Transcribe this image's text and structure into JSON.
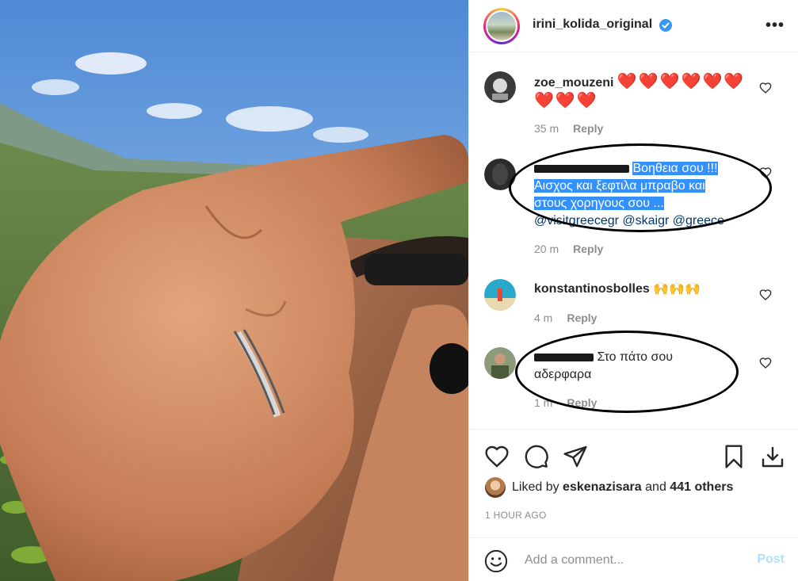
{
  "post": {
    "author": "irini_kolida_original",
    "menu_icon": "more-horizontal-icon"
  },
  "comments": [
    {
      "username": "zoe_mouzeni",
      "text": "❤️❤️❤️❤️❤️❤️❤️❤️❤️",
      "time": "35 m",
      "reply_label": "Reply"
    },
    {
      "username": "",
      "selected_text": "Βοηθεια σου !!! Αισχος και ξεφτιλα μπραβο και στους χορηγους σου ...",
      "mentions": "@visitgreecegr @skaigr @greece",
      "time": "20 m",
      "reply_label": "Reply"
    },
    {
      "username": "konstantinosbolles",
      "text": "🙌🙌🙌",
      "time": "4 m",
      "reply_label": "Reply"
    },
    {
      "username": "",
      "text": "Στο πάτο σου αδερφαρα",
      "time": "1 m",
      "reply_label": "Reply"
    }
  ],
  "actions": {
    "liked_by_prefix": "Liked by",
    "liked_by_user": "eskenazisara",
    "liked_by_and": "and",
    "others_count": "441 others",
    "time_ago": "1 HOUR AGO"
  },
  "composer": {
    "placeholder": "Add a comment...",
    "post_label": "Post"
  },
  "colors": {
    "selection": "#3390ff",
    "heart": "#e0102f",
    "verified": "#3897f0",
    "post_disabled": "#b2dffc"
  }
}
